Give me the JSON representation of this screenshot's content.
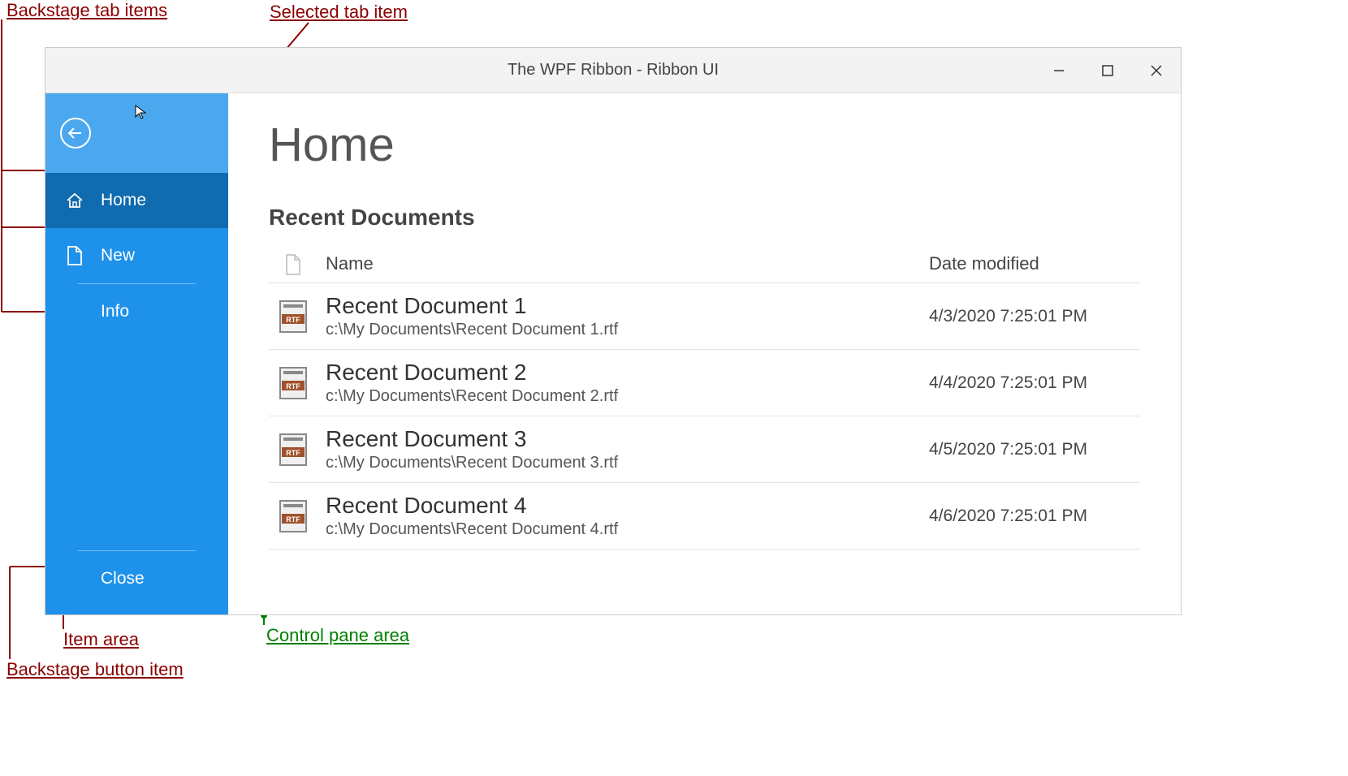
{
  "annotations": {
    "backstage_tab_items": "Backstage tab items",
    "selected_tab_item": "Selected tab item",
    "item_area": "Item area",
    "backstage_button_item": "Backstage button item",
    "control_pane_area": "Control pane area"
  },
  "window": {
    "title": "The WPF Ribbon - Ribbon UI"
  },
  "sidebar": {
    "items": [
      {
        "label": "Home",
        "icon": "home"
      },
      {
        "label": "New",
        "icon": "file"
      },
      {
        "label": "Info",
        "icon": ""
      },
      {
        "label": "Close",
        "icon": ""
      }
    ]
  },
  "content": {
    "title": "Home",
    "section": "Recent Documents",
    "headers": {
      "name": "Name",
      "date": "Date modified"
    },
    "documents": [
      {
        "name": "Recent Document 1",
        "path": "c:\\My Documents\\Recent Document 1.rtf",
        "date": "4/3/2020 7:25:01 PM"
      },
      {
        "name": "Recent Document 2",
        "path": "c:\\My Documents\\Recent Document 2.rtf",
        "date": "4/4/2020 7:25:01 PM"
      },
      {
        "name": "Recent Document 3",
        "path": "c:\\My Documents\\Recent Document 3.rtf",
        "date": "4/5/2020 7:25:01 PM"
      },
      {
        "name": "Recent Document 4",
        "path": "c:\\My Documents\\Recent Document 4.rtf",
        "date": "4/6/2020 7:25:01 PM"
      }
    ]
  }
}
